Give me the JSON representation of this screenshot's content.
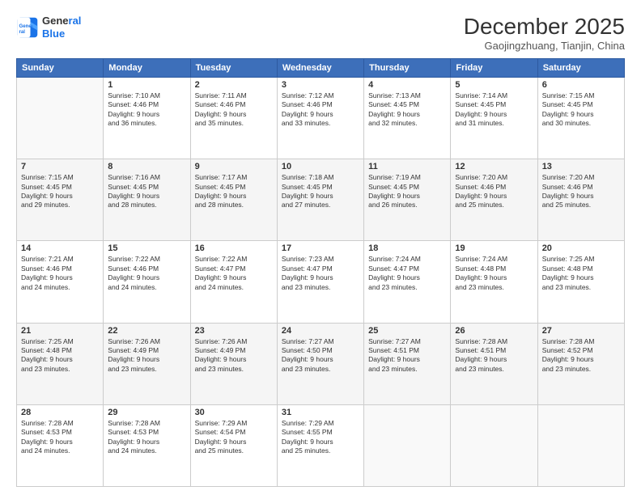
{
  "header": {
    "logo_line1": "General",
    "logo_line2": "Blue",
    "month": "December 2025",
    "location": "Gaojingzhuang, Tianjin, China"
  },
  "weekdays": [
    "Sunday",
    "Monday",
    "Tuesday",
    "Wednesday",
    "Thursday",
    "Friday",
    "Saturday"
  ],
  "weeks": [
    [
      {
        "day": "",
        "info": ""
      },
      {
        "day": "1",
        "info": "Sunrise: 7:10 AM\nSunset: 4:46 PM\nDaylight: 9 hours\nand 36 minutes."
      },
      {
        "day": "2",
        "info": "Sunrise: 7:11 AM\nSunset: 4:46 PM\nDaylight: 9 hours\nand 35 minutes."
      },
      {
        "day": "3",
        "info": "Sunrise: 7:12 AM\nSunset: 4:46 PM\nDaylight: 9 hours\nand 33 minutes."
      },
      {
        "day": "4",
        "info": "Sunrise: 7:13 AM\nSunset: 4:45 PM\nDaylight: 9 hours\nand 32 minutes."
      },
      {
        "day": "5",
        "info": "Sunrise: 7:14 AM\nSunset: 4:45 PM\nDaylight: 9 hours\nand 31 minutes."
      },
      {
        "day": "6",
        "info": "Sunrise: 7:15 AM\nSunset: 4:45 PM\nDaylight: 9 hours\nand 30 minutes."
      }
    ],
    [
      {
        "day": "7",
        "info": "Sunrise: 7:15 AM\nSunset: 4:45 PM\nDaylight: 9 hours\nand 29 minutes."
      },
      {
        "day": "8",
        "info": "Sunrise: 7:16 AM\nSunset: 4:45 PM\nDaylight: 9 hours\nand 28 minutes."
      },
      {
        "day": "9",
        "info": "Sunrise: 7:17 AM\nSunset: 4:45 PM\nDaylight: 9 hours\nand 28 minutes."
      },
      {
        "day": "10",
        "info": "Sunrise: 7:18 AM\nSunset: 4:45 PM\nDaylight: 9 hours\nand 27 minutes."
      },
      {
        "day": "11",
        "info": "Sunrise: 7:19 AM\nSunset: 4:45 PM\nDaylight: 9 hours\nand 26 minutes."
      },
      {
        "day": "12",
        "info": "Sunrise: 7:20 AM\nSunset: 4:46 PM\nDaylight: 9 hours\nand 25 minutes."
      },
      {
        "day": "13",
        "info": "Sunrise: 7:20 AM\nSunset: 4:46 PM\nDaylight: 9 hours\nand 25 minutes."
      }
    ],
    [
      {
        "day": "14",
        "info": "Sunrise: 7:21 AM\nSunset: 4:46 PM\nDaylight: 9 hours\nand 24 minutes."
      },
      {
        "day": "15",
        "info": "Sunrise: 7:22 AM\nSunset: 4:46 PM\nDaylight: 9 hours\nand 24 minutes."
      },
      {
        "day": "16",
        "info": "Sunrise: 7:22 AM\nSunset: 4:47 PM\nDaylight: 9 hours\nand 24 minutes."
      },
      {
        "day": "17",
        "info": "Sunrise: 7:23 AM\nSunset: 4:47 PM\nDaylight: 9 hours\nand 23 minutes."
      },
      {
        "day": "18",
        "info": "Sunrise: 7:24 AM\nSunset: 4:47 PM\nDaylight: 9 hours\nand 23 minutes."
      },
      {
        "day": "19",
        "info": "Sunrise: 7:24 AM\nSunset: 4:48 PM\nDaylight: 9 hours\nand 23 minutes."
      },
      {
        "day": "20",
        "info": "Sunrise: 7:25 AM\nSunset: 4:48 PM\nDaylight: 9 hours\nand 23 minutes."
      }
    ],
    [
      {
        "day": "21",
        "info": "Sunrise: 7:25 AM\nSunset: 4:48 PM\nDaylight: 9 hours\nand 23 minutes."
      },
      {
        "day": "22",
        "info": "Sunrise: 7:26 AM\nSunset: 4:49 PM\nDaylight: 9 hours\nand 23 minutes."
      },
      {
        "day": "23",
        "info": "Sunrise: 7:26 AM\nSunset: 4:49 PM\nDaylight: 9 hours\nand 23 minutes."
      },
      {
        "day": "24",
        "info": "Sunrise: 7:27 AM\nSunset: 4:50 PM\nDaylight: 9 hours\nand 23 minutes."
      },
      {
        "day": "25",
        "info": "Sunrise: 7:27 AM\nSunset: 4:51 PM\nDaylight: 9 hours\nand 23 minutes."
      },
      {
        "day": "26",
        "info": "Sunrise: 7:28 AM\nSunset: 4:51 PM\nDaylight: 9 hours\nand 23 minutes."
      },
      {
        "day": "27",
        "info": "Sunrise: 7:28 AM\nSunset: 4:52 PM\nDaylight: 9 hours\nand 23 minutes."
      }
    ],
    [
      {
        "day": "28",
        "info": "Sunrise: 7:28 AM\nSunset: 4:53 PM\nDaylight: 9 hours\nand 24 minutes."
      },
      {
        "day": "29",
        "info": "Sunrise: 7:28 AM\nSunset: 4:53 PM\nDaylight: 9 hours\nand 24 minutes."
      },
      {
        "day": "30",
        "info": "Sunrise: 7:29 AM\nSunset: 4:54 PM\nDaylight: 9 hours\nand 25 minutes."
      },
      {
        "day": "31",
        "info": "Sunrise: 7:29 AM\nSunset: 4:55 PM\nDaylight: 9 hours\nand 25 minutes."
      },
      {
        "day": "",
        "info": ""
      },
      {
        "day": "",
        "info": ""
      },
      {
        "day": "",
        "info": ""
      }
    ]
  ]
}
